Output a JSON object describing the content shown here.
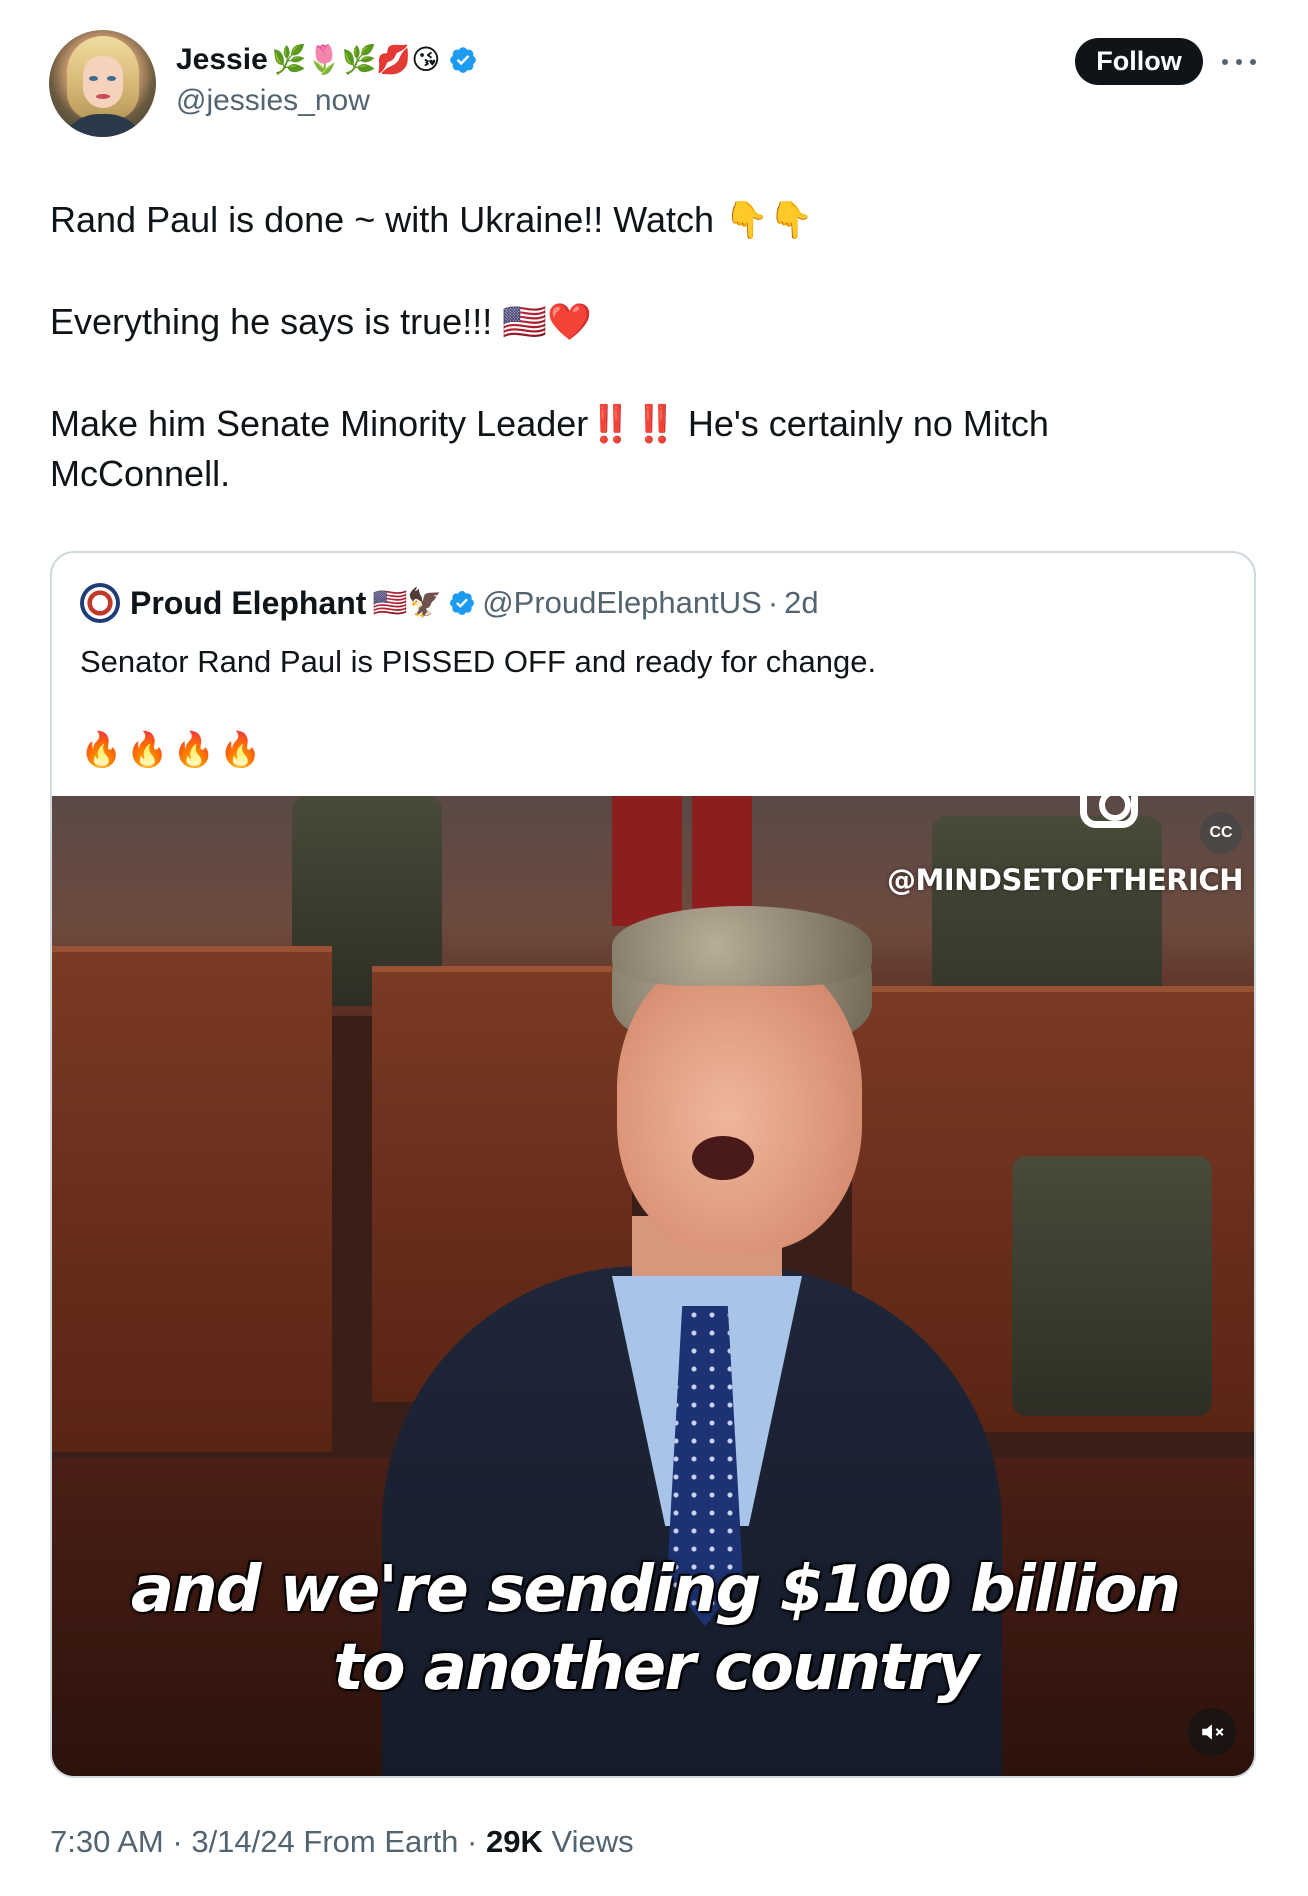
{
  "author": {
    "display_name": "Jessie",
    "name_emojis": "🌿🌷🌿💋😘",
    "handle": "@jessies_now",
    "verified": true
  },
  "actions": {
    "follow_label": "Follow",
    "more_icon": "more-horizontal-icon"
  },
  "tweet": {
    "line1": "Rand Paul is done ~ with Ukraine!!  Watch  👇👇",
    "line2": "Everything he says is true!!! 🇺🇸❤️",
    "line3a": "Make him Senate Minority Leader‼️‼️ He's certainly no Mitch",
    "line3b": "McConnell."
  },
  "quote": {
    "display_name": "Proud Elephant",
    "name_emojis": "🇺🇸🦅",
    "handle": "@ProudElephantUS",
    "separator": "·",
    "time": "2d",
    "text": "Senator Rand Paul is PISSED OFF and ready for change.",
    "fires": "🔥🔥🔥🔥"
  },
  "video": {
    "watermark": "@MINDSETOFTHERICH",
    "caption_line1": "and we're sending $100 billion",
    "caption_line2": "to another country",
    "captions_badge": "CC",
    "muted": true
  },
  "meta": {
    "time": "7:30 AM",
    "sep1": "·",
    "date": "3/14/24",
    "source": "From Earth",
    "sep2": "·",
    "views_count": "29K",
    "views_label": "Views"
  },
  "colors": {
    "text_primary": "#0f1419",
    "text_secondary": "#536471",
    "verified_blue": "#1d9bf0",
    "border": "#cfd9de"
  }
}
